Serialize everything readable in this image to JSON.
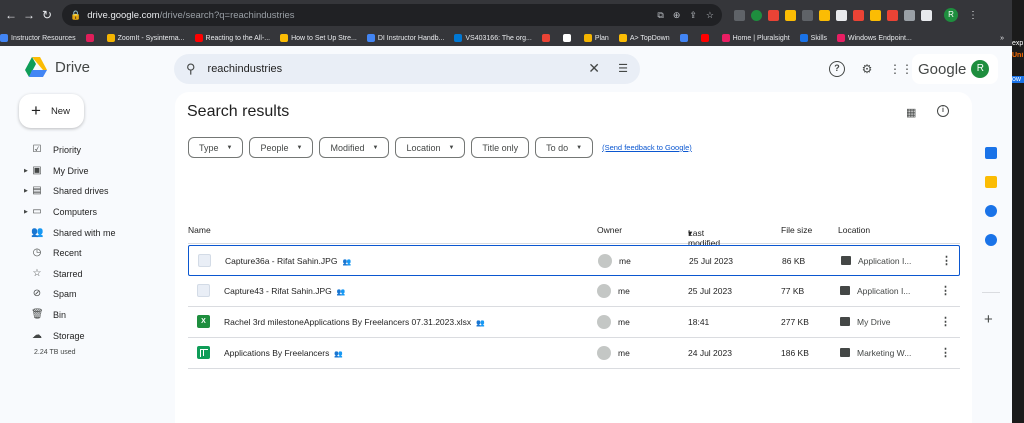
{
  "browser": {
    "url_host": "drive.google.com",
    "url_path": "/drive/search?q=reachindustries",
    "bookmarks": [
      {
        "label": "Instructor Resources",
        "color": "#4285f4"
      },
      {
        "label": "",
        "color": "#e01e5a"
      },
      {
        "label": "ZoomIt - Sysinterna...",
        "color": "#f4b400"
      },
      {
        "label": "Reacting to the All-...",
        "color": "#ff0000"
      },
      {
        "label": "How to Set Up Stre...",
        "color": "#fbbc04"
      },
      {
        "label": "DI Instructor Handb...",
        "color": "#4285f4"
      },
      {
        "label": "VS403166: The org...",
        "color": "#0078d4"
      },
      {
        "label": "",
        "color": "#ea4335"
      },
      {
        "label": "",
        "color": "#ffffff"
      },
      {
        "label": "Plan",
        "color": "#f4b400"
      },
      {
        "label": "A> TopDown",
        "color": "#fbbc04"
      },
      {
        "label": "",
        "color": "#4285f4"
      },
      {
        "label": "",
        "color": "#ff0000"
      },
      {
        "label": "Home | Pluralsight",
        "color": "#e91e63"
      },
      {
        "label": "Skills",
        "color": "#1a73e8"
      },
      {
        "label": "Windows Endpoint...",
        "color": "#e91e63"
      }
    ],
    "bookmarks_more": "»",
    "profile_initial": "R"
  },
  "app": {
    "name": "Drive",
    "search": {
      "value": "reachindustries"
    },
    "google_word": "Google",
    "avatar_initial": "R",
    "new_label": "New"
  },
  "sidebar": {
    "items": [
      {
        "label": "Priority",
        "icon": "priority-icon",
        "glyph": "☑",
        "caret": false
      },
      {
        "label": "My Drive",
        "icon": "my-drive-icon",
        "glyph": "▣",
        "caret": true
      },
      {
        "label": "Shared drives",
        "icon": "shared-drives-icon",
        "glyph": "▤",
        "caret": true
      },
      {
        "label": "Computers",
        "icon": "computers-icon",
        "glyph": "▭",
        "caret": true
      },
      {
        "label": "Shared with me",
        "icon": "shared-with-me-icon",
        "glyph": "👥",
        "caret": false
      },
      {
        "label": "Recent",
        "icon": "recent-icon",
        "glyph": "◷",
        "caret": false
      },
      {
        "label": "Starred",
        "icon": "starred-icon",
        "glyph": "☆",
        "caret": false
      },
      {
        "label": "Spam",
        "icon": "spam-icon",
        "glyph": "⊘",
        "caret": false
      },
      {
        "label": "Bin",
        "icon": "bin-icon",
        "glyph": "🗑",
        "caret": false
      },
      {
        "label": "Storage",
        "icon": "storage-icon",
        "glyph": "☁",
        "caret": false
      }
    ],
    "storage_used": "2.24 TB used"
  },
  "main": {
    "title": "Search results",
    "filters": [
      {
        "label": "Type",
        "dropdown": true
      },
      {
        "label": "People",
        "dropdown": true
      },
      {
        "label": "Modified",
        "dropdown": true
      },
      {
        "label": "Location",
        "dropdown": true
      },
      {
        "label": "Title only",
        "dropdown": false
      },
      {
        "label": "To do",
        "dropdown": true
      }
    ],
    "feedback_link": "(Send feedback to Google)",
    "columns": {
      "name": "Name",
      "owner": "Owner",
      "modified": "Last modified",
      "size": "File size",
      "location": "Location"
    },
    "rows": [
      {
        "name": "Capture36a - Rifat Sahin.JPG",
        "type": "img",
        "owner": "me",
        "modified": "25 Jul 2023",
        "size": "86 KB",
        "location": "Application I...",
        "selected": true
      },
      {
        "name": "Capture43 - Rifat Sahin.JPG",
        "type": "img",
        "owner": "me",
        "modified": "25 Jul 2023",
        "size": "77 KB",
        "location": "Application I...",
        "selected": false
      },
      {
        "name": "Rachel 3rd milestoneApplications By Freelancers 07.31.2023.xlsx",
        "type": "xlsx",
        "owner": "me",
        "modified": "18:41",
        "size": "277 KB",
        "location": "My Drive",
        "selected": false
      },
      {
        "name": "Applications By Freelancers",
        "type": "sheet",
        "owner": "me",
        "modified": "24 Jul 2023",
        "size": "186 KB",
        "location": "Marketing W...",
        "selected": false
      }
    ]
  },
  "side_panel": {
    "icons": [
      {
        "name": "calendar-icon",
        "color": "#1a73e8"
      },
      {
        "name": "keep-icon",
        "color": "#fbbc04"
      },
      {
        "name": "tasks-icon",
        "color": "#1a73e8"
      },
      {
        "name": "contacts-icon",
        "color": "#1a73e8"
      }
    ]
  },
  "right_strip": {
    "peek_text_1": "exp",
    "peek_text_2": "Uni",
    "peek_text_3": "ow"
  }
}
